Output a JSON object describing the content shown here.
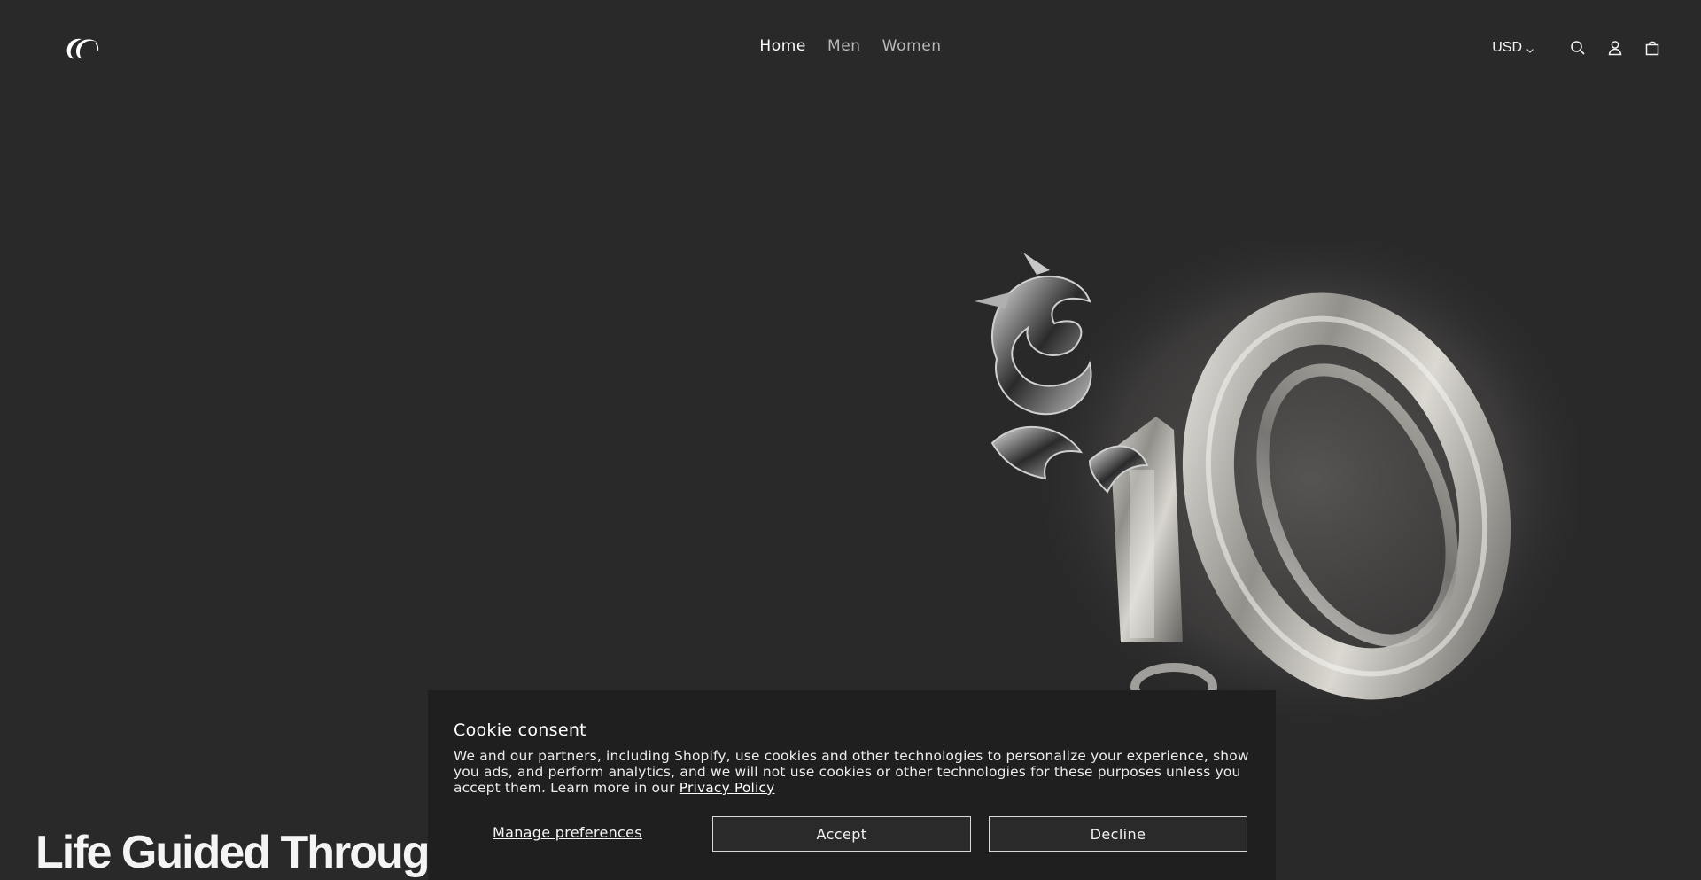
{
  "header": {
    "nav": [
      {
        "label": "Home",
        "active": true
      },
      {
        "label": "Men",
        "active": false
      },
      {
        "label": "Women",
        "active": false
      }
    ],
    "currency": "USD",
    "icons": [
      "logo-icon",
      "chevron-down-icon",
      "search-icon",
      "account-icon",
      "cart-icon"
    ]
  },
  "hero": {
    "headline": "Life Guided Through",
    "art": "dragon-and-ten-chrome-graphic"
  },
  "cookie": {
    "title": "Cookie consent",
    "text": "We and our partners, including Shopify, use cookies and other technologies to personalize your experience, show you ads, and perform analytics, and we will not use cookies or other technologies for these purposes unless you accept them. Learn more in our",
    "link": "Privacy Policy",
    "manage": "Manage preferences",
    "accept": "Accept",
    "decline": "Decline"
  },
  "colors": {
    "background": "#2a292a",
    "banner": "#201f20",
    "text": "#f2f2f2"
  }
}
